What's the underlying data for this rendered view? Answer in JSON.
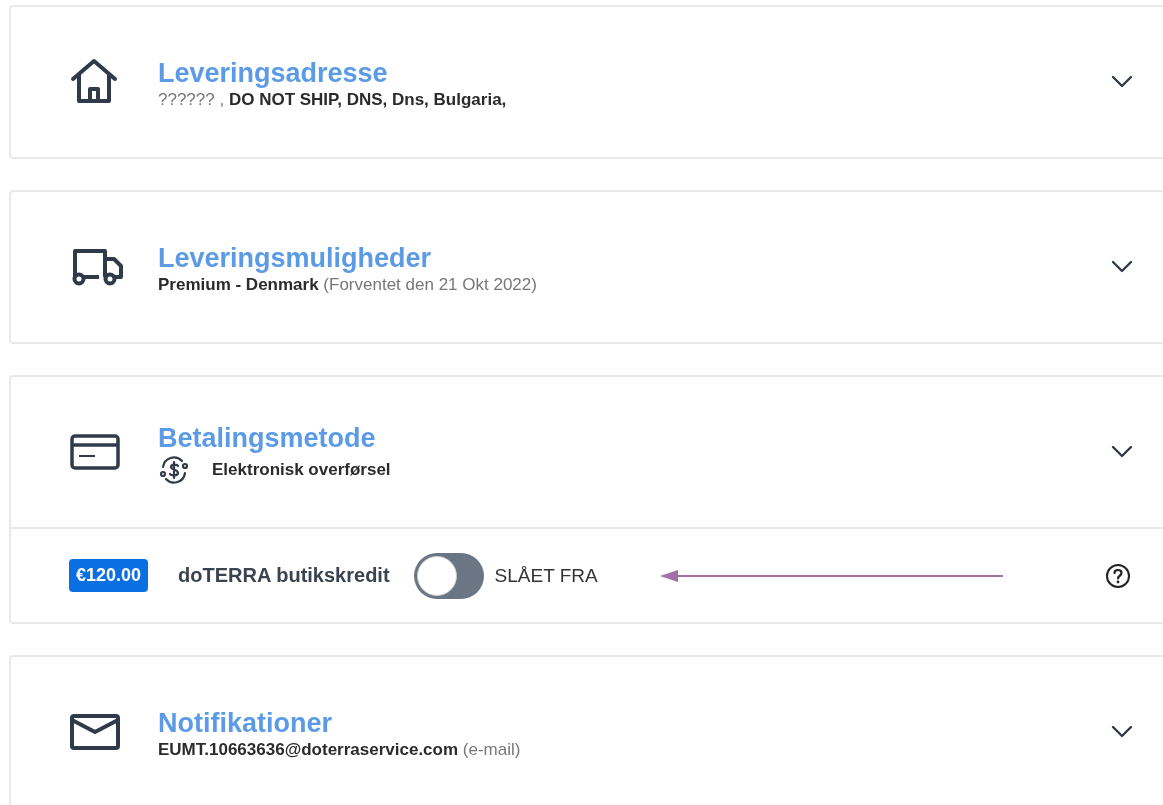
{
  "sections": [
    {
      "title": "Leveringsadresse",
      "subtitle": "?????? , **DO NOT SHIP, DNS, Dns, Bulgaria,**"
    },
    {
      "title": "Leveringsmuligheder",
      "subtitle": "**Premium - Denmark** (Forventet den 21 Okt 2022)"
    },
    {
      "title": "Betalingsmetode",
      "method": "Elektronisk overførsel",
      "credit": {
        "amount": "€120.00",
        "label": "doTERRA butikskredit",
        "toggle": {
          "on": false,
          "label": "SLÅET FRA"
        }
      }
    },
    {
      "title": "Notifikationer",
      "subtitle": "**EUMT.10663636@doterraservice.com** (e-mail)"
    }
  ]
}
